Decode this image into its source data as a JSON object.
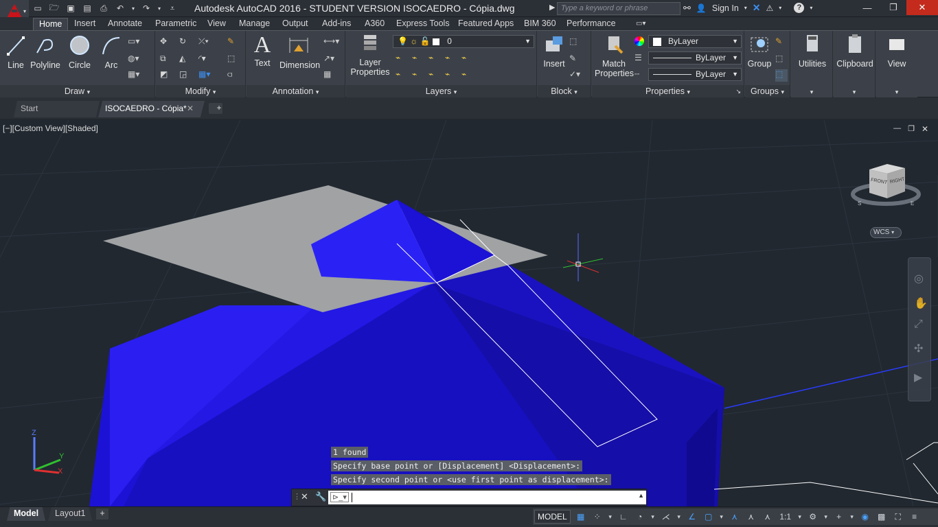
{
  "window": {
    "title": "Autodesk AutoCAD 2016 - STUDENT VERSION    ISOCAEDRO - Cópia.dwg",
    "search_placeholder": "Type a keyword or phrase",
    "sign_in": "Sign In"
  },
  "ribbon_tabs": [
    "Home",
    "Insert",
    "Annotate",
    "Parametric",
    "View",
    "Manage",
    "Output",
    "Add-ins",
    "A360",
    "Express Tools",
    "Featured Apps",
    "BIM 360",
    "Performance"
  ],
  "active_tab": "Home",
  "panels": {
    "draw": {
      "title": "Draw",
      "line": "Line",
      "polyline": "Polyline",
      "circle": "Circle",
      "arc": "Arc"
    },
    "modify": {
      "title": "Modify"
    },
    "annotation": {
      "title": "Annotation",
      "text": "Text",
      "dimension": "Dimension"
    },
    "layers": {
      "title": "Layers",
      "layer_properties_1": "Layer",
      "layer_properties_2": "Properties",
      "current_layer": "0"
    },
    "block": {
      "title": "Block",
      "insert": "Insert"
    },
    "properties": {
      "title": "Properties",
      "match_1": "Match",
      "match_2": "Properties",
      "color": "ByLayer",
      "linetype": "ByLayer",
      "lineweight": "ByLayer"
    },
    "groups": {
      "title": "Groups",
      "group": "Group"
    },
    "utilities": {
      "title": "Utilities"
    },
    "clipboard": {
      "title": "Clipboard"
    },
    "view": {
      "title": "View"
    }
  },
  "file_tabs": {
    "start": "Start",
    "current": "ISOCAEDRO - Cópia*"
  },
  "viewport": {
    "label": "[−][Custom View][Shaded]",
    "wcs": "WCS",
    "viewcube_front": "FRONT",
    "viewcube_right": "RIGHT",
    "compass_s": "S",
    "compass_e": "E",
    "ucs_z": "Z",
    "ucs_y": "Y",
    "ucs_x": "X"
  },
  "command": {
    "history": [
      "1 found",
      "Specify base point or [Displacement] <Displacement>:",
      "Specify second point or <use first point as displacement>:"
    ],
    "input": ""
  },
  "layout_tabs": [
    "Model",
    "Layout1"
  ],
  "status": {
    "space": "MODEL",
    "scale": "1:1"
  },
  "colors": {
    "solid_blue": "#1a10d8",
    "plane_gray": "#a0a2a4",
    "background": "#212830"
  }
}
